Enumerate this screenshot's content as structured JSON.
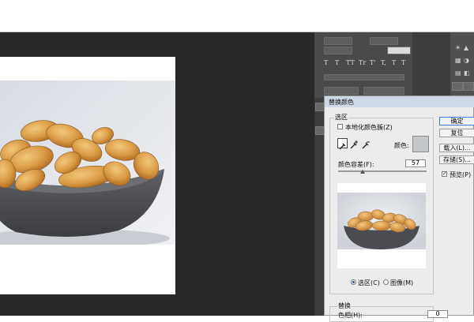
{
  "dialog": {
    "title": "替换颜色",
    "selection_group": "选区",
    "localized_colors_label": "本地化颜色簇(Z)",
    "color_label": "颜色:",
    "fuzziness_label": "颜色容差(F):",
    "fuzziness_value": "57",
    "fuzziness_fraction": 0.28,
    "radio_selection": "选区(C)",
    "radio_image": "图像(M)",
    "replace_group": "替换",
    "hue_label": "色相(H):",
    "hue_value": "0",
    "buttons": {
      "ok": "确定",
      "reset": "复位",
      "load": "载入(L)...",
      "save": "存储(S)...",
      "preview_label": "预览(P)"
    },
    "eyedroppers": [
      "eyedropper-icon",
      "eyedropper-plus-icon",
      "eyedropper-minus-icon"
    ],
    "selected_color_hex": "#c2c7cc"
  },
  "character_panel": {
    "glyphs": [
      "T",
      "T",
      "TT",
      "Tr",
      "T'",
      "T,",
      "T",
      "T"
    ]
  },
  "canvas": {
    "background": "#282828",
    "document_background": "#ffffff",
    "photo_subject": "almonds-in-gray-bowl"
  }
}
